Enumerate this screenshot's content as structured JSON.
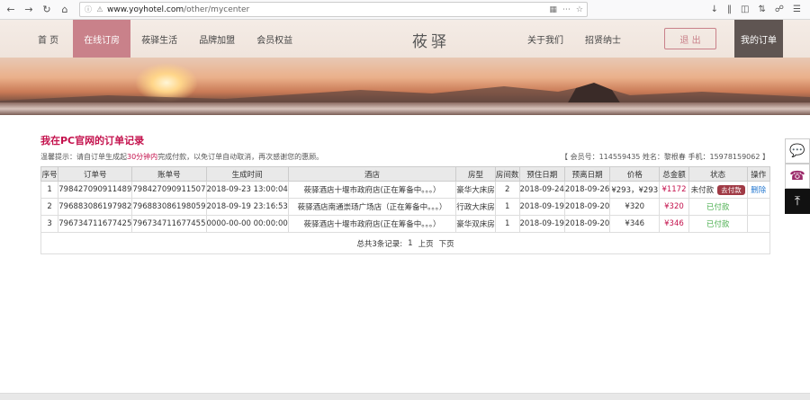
{
  "browser": {
    "url_host": "www.yoyhotel.com",
    "url_path": "/other/mycenter"
  },
  "nav": {
    "home": "首 页",
    "online_booking": "在线订房",
    "living": "莜驿生活",
    "franchise": "品牌加盟",
    "member": "会员权益",
    "logo": "莜驿",
    "about": "关于我们",
    "recruit": "招贤纳士",
    "logout": "退 出",
    "my_orders": "我的订单"
  },
  "page": {
    "title": "我在PC官网的订单记录",
    "tip_prefix": "温馨提示：请自订单生成起",
    "tip_highlight": "30分钟内",
    "tip_suffix": "完成付款，以免订单自动取消，再次感谢您的惠顾。",
    "member_info": "【   会员号：114559435   姓名：黎根春   手机：15978159062   】"
  },
  "table": {
    "headers": [
      "序号",
      "订单号",
      "账单号",
      "生成时间",
      "酒店",
      "房型",
      "房间数",
      "预住日期",
      "预离日期",
      "价格",
      "总金额",
      "状态",
      "操作"
    ],
    "rows": [
      {
        "no": "1",
        "order": "798427090911489",
        "bill": "798427090911507",
        "time": "2018-09-23 13:00:04",
        "hotel": "莜驿酒店十堰市政府店(正在筹备中。。。）",
        "room": "豪华大床房",
        "count": "2",
        "checkin": "2018-09-24",
        "checkout": "2018-09-26",
        "price": "¥293，¥293",
        "total": "¥1172",
        "status": "未付款",
        "pay": "去付款",
        "op": "删除"
      },
      {
        "no": "2",
        "order": "796883086197982",
        "bill": "796883086198059",
        "time": "2018-09-19 23:16:53",
        "hotel": "莜驿酒店南通崇玚广场店（正在筹备中。。。）",
        "room": "行政大床房",
        "count": "1",
        "checkin": "2018-09-19",
        "checkout": "2018-09-20",
        "price": "¥320",
        "total": "¥320",
        "status": "已付款",
        "pay": "",
        "op": ""
      },
      {
        "no": "3",
        "order": "796734711677425",
        "bill": "796734711677455",
        "time": "0000-00-00 00:00:00",
        "hotel": "莜驿酒店十堰市政府店(正在筹备中。。。）",
        "room": "豪华双床房",
        "count": "1",
        "checkin": "2018-09-19",
        "checkout": "2018-09-20",
        "price": "¥346",
        "total": "¥346",
        "status": "已付款",
        "pay": "",
        "op": ""
      }
    ],
    "pager": {
      "summary": "总共3条记录:",
      "page": "1",
      "prev": "上页",
      "next": "下页"
    }
  },
  "icons": {
    "side_chat": "chat-icon",
    "side_phone": "phone-icon",
    "side_top": "back-to-top-icon"
  },
  "colors": {
    "accent": "#c4124d",
    "nav_active": "#c9818a",
    "paid": "#4caf50"
  }
}
